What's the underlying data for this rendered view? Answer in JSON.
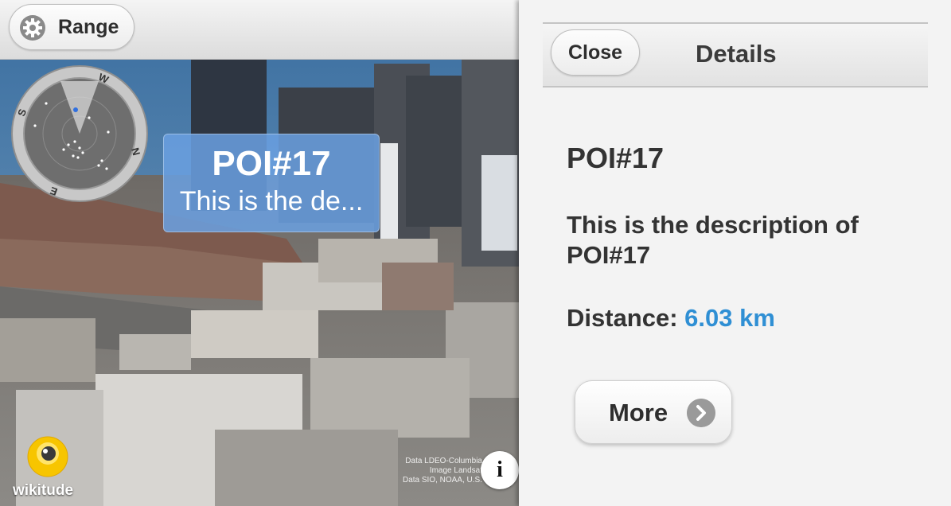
{
  "toolbar": {
    "range_label": "Range"
  },
  "radar": {
    "compass_letters": [
      "W",
      "N",
      "E",
      "S"
    ],
    "icon": "radar-compass-icon"
  },
  "poi_marker": {
    "title": "POI#17",
    "description": "This is the de..."
  },
  "branding": {
    "logo_text": "wikitude"
  },
  "map_credit": [
    "Data LDEO-Columbia",
    "Image Landsat",
    "Data SIO, NOAA, U.S."
  ],
  "info_button": {
    "label": "i"
  },
  "details_panel": {
    "close_label": "Close",
    "header_title": "Details",
    "poi_title": "POI#17",
    "description": "This is the description of POI#17",
    "distance_label": "Distance:",
    "distance_value": "6.03 km",
    "more_label": "More"
  },
  "colors": {
    "accent": "#2f8fd4",
    "poi_marker_bg": "#6aa0e1",
    "panel_bg": "#f3f3f3",
    "logo_yellow": "#f7c500"
  }
}
